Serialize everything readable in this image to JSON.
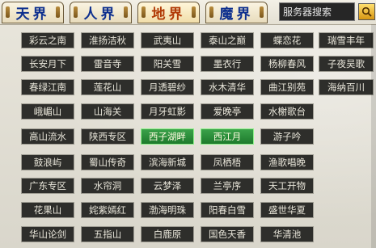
{
  "tabs": [
    {
      "label": "天界",
      "active": false
    },
    {
      "label": "人界",
      "active": false
    },
    {
      "label": "地界",
      "active": true
    },
    {
      "label": "魔界",
      "active": false
    }
  ],
  "search": {
    "value": "服务器搜索"
  },
  "servers": [
    [
      "彩云之南",
      "淮扬洁秋",
      "武夷山",
      "泰山之巅",
      "蝶恋花",
      "瑞雪丰年"
    ],
    [
      "长安月下",
      "雷音寺",
      "阳关雪",
      "墨衣行",
      "杨柳春风",
      "子夜吴歌"
    ],
    [
      "春绿江南",
      "莲花山",
      "月透碧纱",
      "水木清华",
      "曲江别苑",
      "海纳百川"
    ],
    [
      "峨嵋山",
      "山海关",
      "月牙虹影",
      "爱晚亭",
      "水榭歌台"
    ],
    [
      "高山流水",
      "陕西专区",
      "西子湖畔",
      "西江月",
      "游子吟"
    ],
    [
      "鼓浪屿",
      "蜀山传奇",
      "滨海新城",
      "凤栖梧",
      "渔歌唱晚"
    ],
    [
      "广东专区",
      "水帘洞",
      "云梦泽",
      "兰亭序",
      "天工开物"
    ],
    [
      "花果山",
      "姹紫嫣红",
      "渤海明珠",
      "阳春白雪",
      "盛世华夏"
    ],
    [
      "华山论剑",
      "五指山",
      "白鹿原",
      "国色天香",
      "华清池"
    ]
  ],
  "selected_servers": [
    "西子湖畔",
    "西江月"
  ],
  "colors": {
    "tab_text": "#0d2f8e",
    "tab_active_text": "#b13a06",
    "button_bg": "#2e2e2b",
    "selected_bg": "#1d7a2c"
  },
  "icons": {
    "search_button": "magnifier-icon"
  }
}
